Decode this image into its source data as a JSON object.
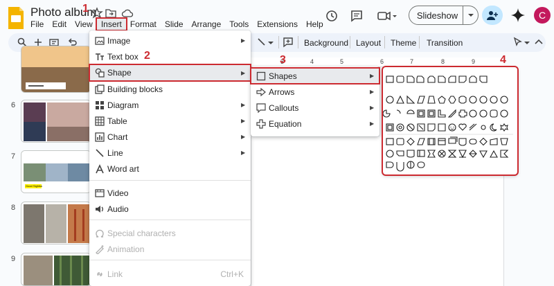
{
  "app": {
    "title": "Photo album",
    "user_initial": "C"
  },
  "menubar": [
    "File",
    "Edit",
    "View",
    "Insert",
    "Format",
    "Slide",
    "Arrange",
    "Tools",
    "Extensions",
    "Help"
  ],
  "header": {
    "slideshow_label": "Slideshow"
  },
  "toolbar": {
    "background": "Background",
    "layout": "Layout",
    "theme": "Theme",
    "transition": "Transition"
  },
  "slides": [
    {
      "number": "",
      "caption": ""
    },
    {
      "number": "6",
      "caption": ""
    },
    {
      "number": "7",
      "caption": "Good Sightss"
    },
    {
      "number": "8",
      "caption": ""
    },
    {
      "number": "9",
      "caption": ""
    }
  ],
  "ruler": [
    "3",
    "4",
    "5",
    "6",
    "7",
    "8",
    "9"
  ],
  "insert_menu": {
    "image": "Image",
    "text_box": "Text box",
    "shape": "Shape",
    "building_blocks": "Building blocks",
    "diagram": "Diagram",
    "table": "Table",
    "chart": "Chart",
    "line": "Line",
    "word_art": "Word art",
    "video": "Video",
    "audio": "Audio",
    "special_characters": "Special characters",
    "animation": "Animation",
    "link": "Link",
    "link_shortcut": "Ctrl+K"
  },
  "shape_submenu": {
    "shapes": "Shapes",
    "arrows": "Arrows",
    "callouts": "Callouts",
    "equation": "Equation"
  },
  "steps": [
    "1",
    "2",
    "3",
    "4"
  ],
  "colors": {
    "annotation": "#cc2a30",
    "share": "#c2e7ff",
    "avatar": "#c3195d"
  }
}
